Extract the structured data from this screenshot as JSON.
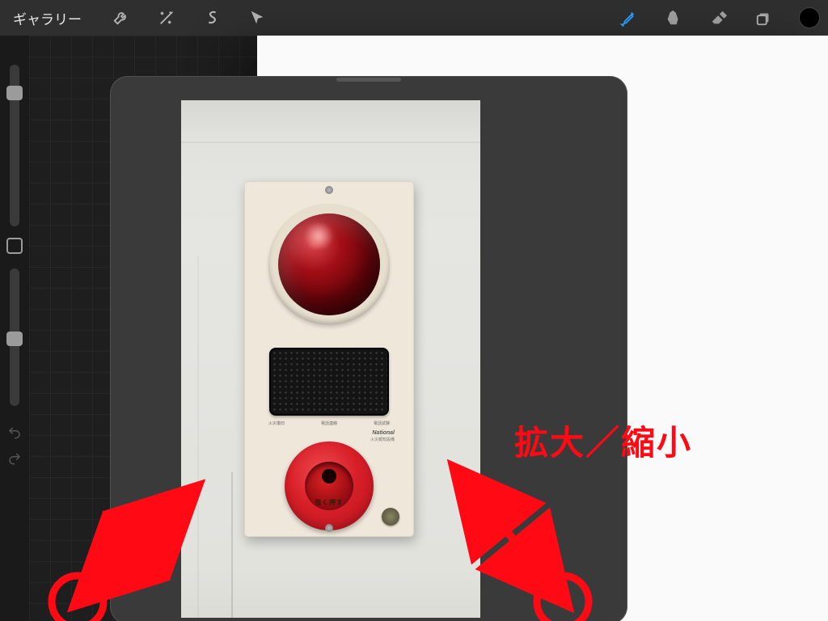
{
  "topbar": {
    "gallery": "ギャラリー",
    "icons_left": [
      "wrench-icon",
      "wand-icon",
      "s-shape-icon",
      "pointer-icon"
    ],
    "icons_right": [
      "brush-icon",
      "smudge-icon",
      "eraser-icon",
      "layers-icon",
      "color-icon"
    ]
  },
  "panel": {
    "brand": "National",
    "sub": "火災報知設備",
    "labels": [
      "火災復旧",
      "電話連絡",
      "電話試験"
    ],
    "push_label": "強く押す"
  },
  "annotation": {
    "text": "拡大／縮小"
  }
}
